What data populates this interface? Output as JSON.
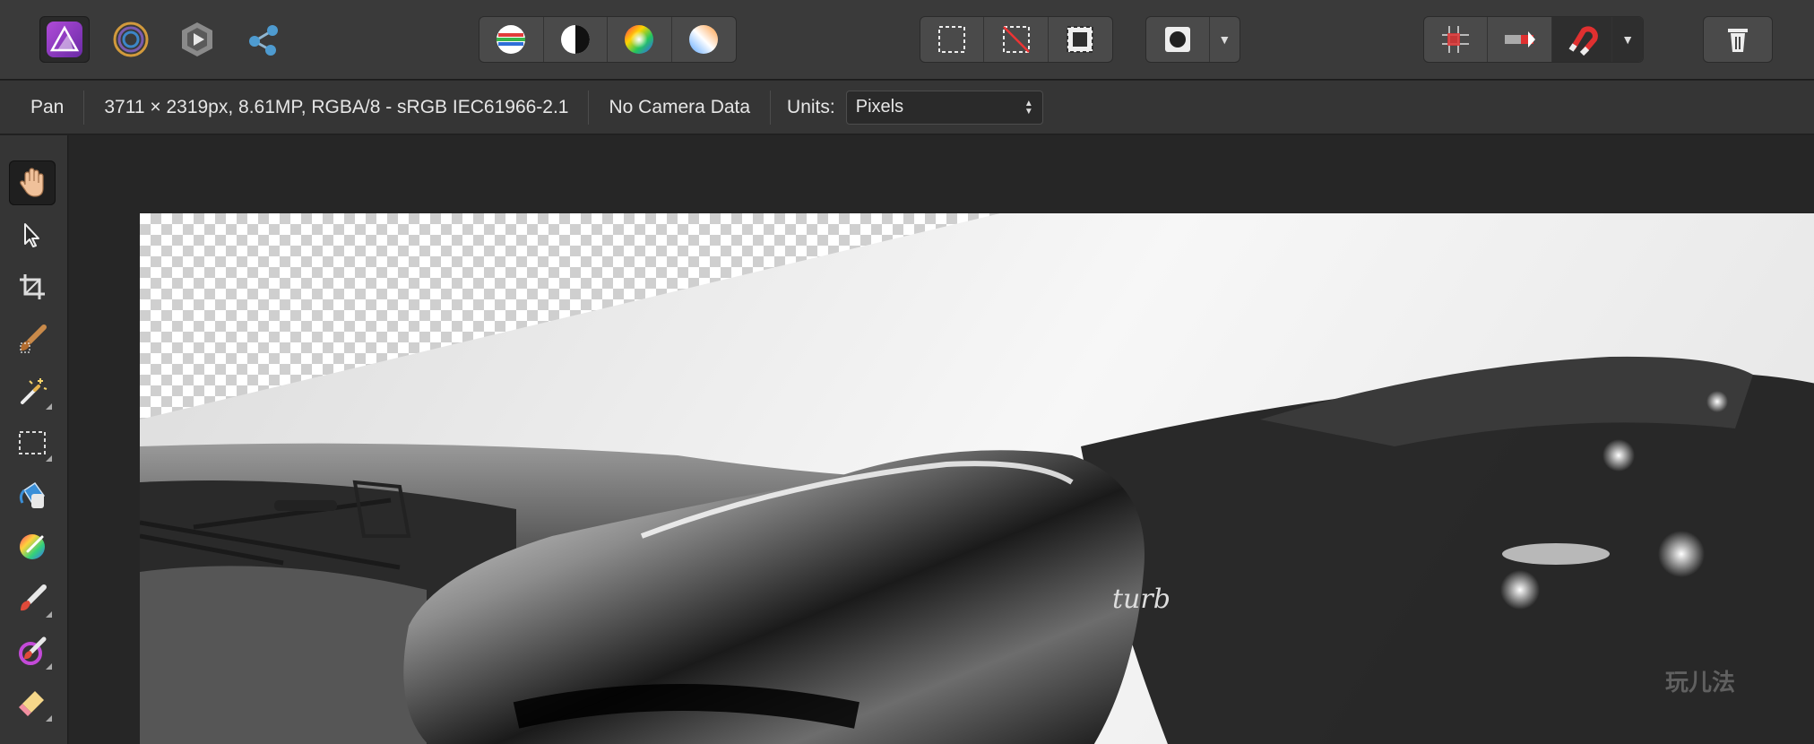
{
  "personas": [
    {
      "name": "photo-persona",
      "active": true
    },
    {
      "name": "liquify-persona",
      "active": false
    },
    {
      "name": "develop-persona",
      "active": false
    },
    {
      "name": "export-persona",
      "active": false
    }
  ],
  "adjust_icons": [
    "levels-icon",
    "black-white-icon",
    "hsl-icon",
    "white-balance-icon"
  ],
  "selection_icons": [
    "marquee-select-icon",
    "deselect-icon",
    "invert-selection-icon"
  ],
  "mask_icons": [
    "quick-mask-icon"
  ],
  "snap_icons": [
    "grid-snap-icon",
    "align-icon",
    "snapping-magnet-icon"
  ],
  "context": {
    "tool": "Pan",
    "doc_info": "3711 × 2319px, 8.61MP, RGBA/8 - sRGB IEC61966-2.1",
    "camera": "No Camera Data",
    "units_label": "Units:",
    "units_value": "Pixels"
  },
  "tools": [
    "hand-tool",
    "move-tool",
    "crop-tool",
    "selection-brush-tool",
    "flood-select-tool",
    "marquee-tool",
    "flood-fill-tool",
    "color-picker-tool",
    "paint-brush-tool",
    "color-replacement-tool",
    "erase-brush-tool"
  ],
  "watermark": "玩儿法"
}
